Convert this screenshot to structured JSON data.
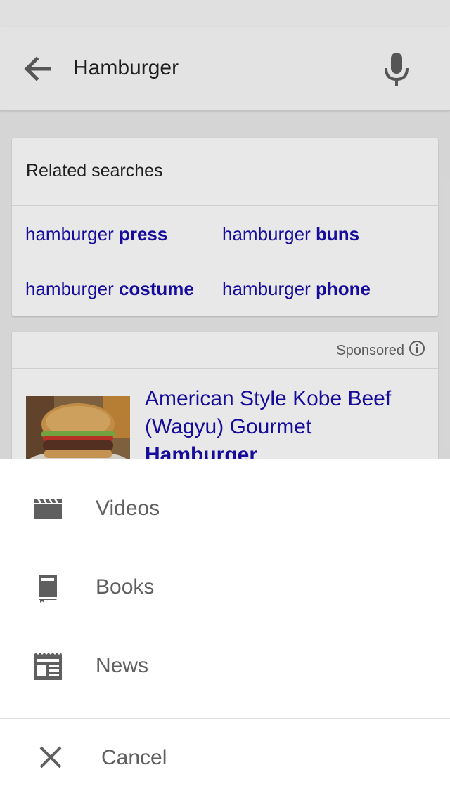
{
  "search": {
    "query": "Hamburger",
    "back_icon": "arrow-back-icon",
    "mic_icon": "microphone-icon"
  },
  "related": {
    "title": "Related searches",
    "items": [
      {
        "prefix": "hamburger ",
        "bold": "press"
      },
      {
        "prefix": "hamburger ",
        "bold": "buns"
      },
      {
        "prefix": "hamburger ",
        "bold": "costume"
      },
      {
        "prefix": "hamburger ",
        "bold": "phone"
      }
    ]
  },
  "ad": {
    "sponsored_label": "Sponsored",
    "info_icon": "info-icon",
    "title_line1": "American Style Kobe Beef",
    "title_line2": "(Wagyu) Gourmet",
    "title_bold": "Hamburger",
    "title_suffix": " ..."
  },
  "sheet": {
    "items": [
      {
        "label": "Videos",
        "icon": "video-clapperboard-icon"
      },
      {
        "label": "Books",
        "icon": "book-icon"
      },
      {
        "label": "News",
        "icon": "newspaper-icon"
      }
    ],
    "cancel_label": "Cancel",
    "cancel_icon": "close-icon"
  },
  "colors": {
    "link": "#1a0dab",
    "sheet_text": "#5f5f5f",
    "icon_gray": "#5f5f5f"
  }
}
